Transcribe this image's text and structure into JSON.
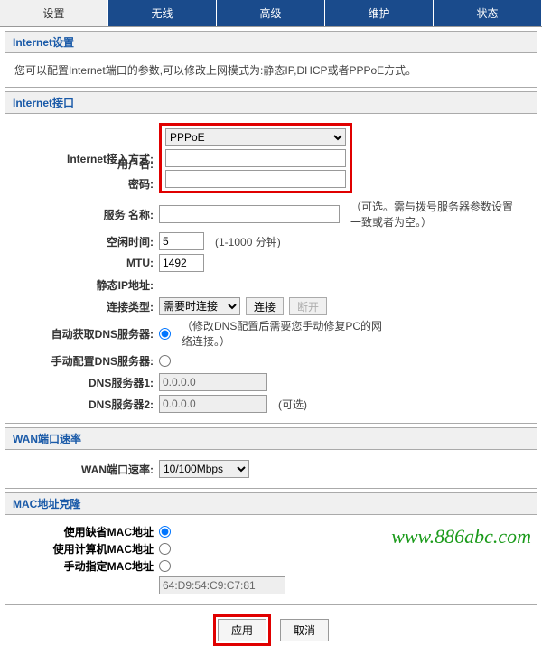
{
  "tabs": {
    "t0": "设置",
    "t1": "无线",
    "t2": "高级",
    "t3": "维护",
    "t4": "状态"
  },
  "internet_settings": {
    "title": "Internet设置",
    "desc": "您可以配置Internet端口的参数,可以修改上网模式为:静态IP,DHCP或者PPPoE方式。"
  },
  "internet_port": {
    "title": "Internet接口",
    "labels": {
      "access": "Internet接入方式:",
      "username": "用户名:",
      "password": "密码:",
      "service_name": "服务 名称:",
      "idle": "空闲时间:",
      "mtu": "MTU:",
      "static_ip": "静态IP地址:",
      "conn_type": "连接类型:",
      "auto_dns": "自动获取DNS服务器:",
      "manual_dns": "手动配置DNS服务器:",
      "dns1": "DNS服务器1:",
      "dns2": "DNS服务器2:"
    },
    "values": {
      "access_select": "PPPoE",
      "username": "",
      "password": "",
      "service_name": "",
      "idle": "5",
      "mtu": "1492",
      "conn_type": "需要时连接",
      "dns1": "0.0.0.0",
      "dns2": "0.0.0.0"
    },
    "hints": {
      "service_name": "（可选。需与拨号服务器参数设置一致或者为空。）",
      "idle": "(1-1000 分钟)",
      "dns_note": "（修改DNS配置后需要您手动修复PC的网络连接。）",
      "dns2": "(可选)",
      "connect": "连接",
      "disconnect": "断开"
    }
  },
  "wan_rate": {
    "title": "WAN端口速率",
    "label": "WAN端口速率:",
    "value": "10/100Mbps"
  },
  "mac_clone": {
    "title": "MAC地址克隆",
    "opt_default": "使用缺省MAC地址",
    "opt_pc": "使用计算机MAC地址",
    "opt_manual": "手动指定MAC地址",
    "mac_value": "64:D9:54:C9:C7:81"
  },
  "buttons": {
    "apply": "应用",
    "cancel": "取消"
  },
  "watermark": "www.886abc.com"
}
